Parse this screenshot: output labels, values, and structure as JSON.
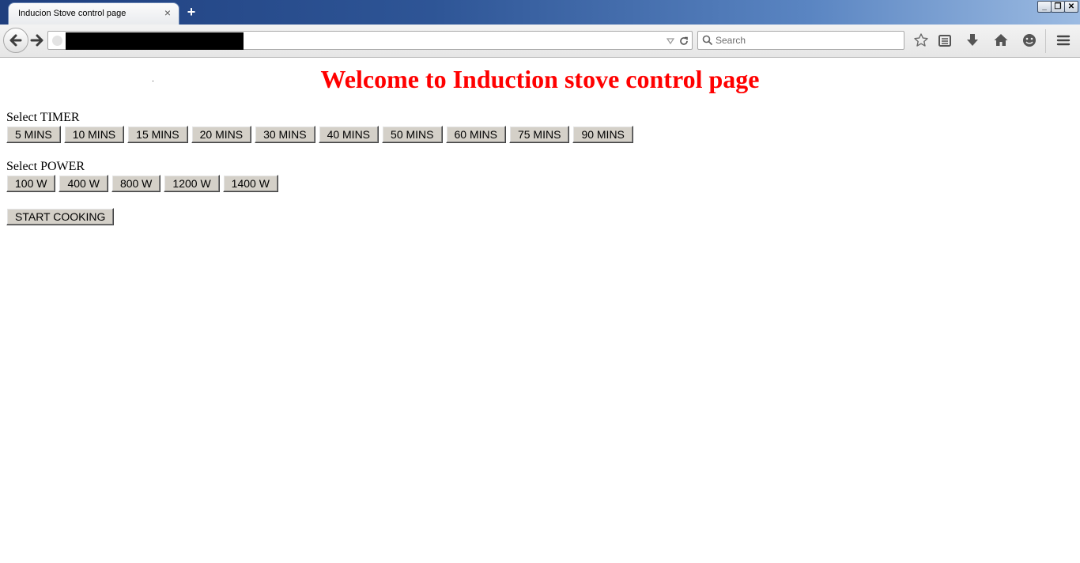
{
  "browser": {
    "tab_title": "Inducion Stove control page",
    "tab_close": "×",
    "new_tab": "+",
    "window_controls": {
      "minimize": "_",
      "restore": "❐",
      "close": "✕"
    },
    "search_placeholder": "Search",
    "toolbar_icons": [
      "back-icon",
      "forward-icon",
      "bookmark-star-icon",
      "reading-list-icon",
      "download-icon",
      "home-icon",
      "hello-icon",
      "menu-icon"
    ]
  },
  "page": {
    "title": "Welcome to Induction stove control page",
    "timer_label": "Select TIMER",
    "timer_options": [
      "5 MINS",
      "10 MINS",
      "15 MINS",
      "20 MINS",
      "30 MINS",
      "40 MINS",
      "50 MINS",
      "60 MINS",
      "75 MINS",
      "90 MINS"
    ],
    "power_label": "Select POWER",
    "power_options": [
      "100 W",
      "400 W",
      "800 W",
      "1200 W",
      "1400 W"
    ],
    "start_label": "START COOKING"
  },
  "colors": {
    "title": "#ff0000",
    "button_face": "#d4d0c8"
  }
}
